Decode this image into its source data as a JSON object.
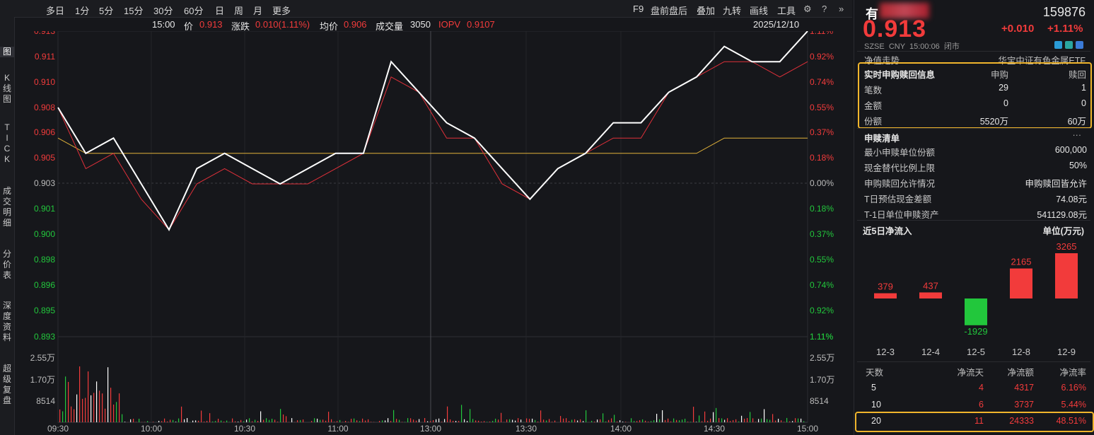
{
  "left_tabs": [
    {
      "label": "图",
      "active": true
    },
    {
      "label": "K\n线\n图"
    },
    {
      "label": "T\nI\nC\nK"
    },
    {
      "label": "成\n交\n明\n细"
    },
    {
      "label": "分\n价\n表"
    },
    {
      "label": "深\n度\n资\n料"
    },
    {
      "label": "超\n级\n复\n盘"
    }
  ],
  "toolbar": {
    "periods": [
      "多日",
      "1分",
      "5分",
      "15分",
      "30分",
      "60分",
      "日",
      "周",
      "月",
      "更多"
    ],
    "right": [
      "F9",
      "盘前盘后",
      "叠加",
      "九转",
      "画线",
      "工具"
    ],
    "icons": [
      "gear-icon",
      "help-icon",
      "double-chevron-right-icon"
    ]
  },
  "info": {
    "time": "15:00",
    "price_label": "价",
    "price": "0.913",
    "change_label": "涨跌",
    "change": "0.010(1.11%)",
    "avg_label": "均价",
    "avg": "0.906",
    "vol_label": "成交量",
    "vol": "3050",
    "iopv_label": "IOPV",
    "iopv": "0.9107",
    "date": "2025/12/10"
  },
  "y_left": [
    "0.913",
    "0.911",
    "0.910",
    "0.908",
    "0.906",
    "0.905",
    "0.903",
    "0.901",
    "0.900",
    "0.898",
    "0.896",
    "0.895",
    "0.893"
  ],
  "y_right": [
    "1.11%",
    "0.92%",
    "0.74%",
    "0.55%",
    "0.37%",
    "0.18%",
    "0.00%",
    "0.18%",
    "0.37%",
    "0.55%",
    "0.74%",
    "0.92%",
    "1.11%"
  ],
  "vol_left": [
    "2.55万",
    "1.70万",
    "8514"
  ],
  "vol_right": [
    "1.11%",
    "2.55万",
    "1.70万",
    "8514"
  ],
  "x_labels": [
    "09:30",
    "10:00",
    "10:30",
    "11:00",
    "13:00",
    "13:30",
    "14:00",
    "14:30",
    "15:00"
  ],
  "quote": {
    "name": "有",
    "code": "159876",
    "price": "0.913",
    "change": "+0.010",
    "change_pct": "+1.11%",
    "meta": "SZSE  CNY  15:00:06  闭市"
  },
  "nav": {
    "label": "净值走势",
    "fund_name": "华宝中证有色金属ETF"
  },
  "realtime": {
    "title": "实时申购赎回信息",
    "col1": "申购",
    "col2": "赎回",
    "rows": [
      {
        "label": "笔数",
        "sub": "29",
        "red": "1"
      },
      {
        "label": "金额",
        "sub": "0",
        "red": "0"
      },
      {
        "label": "份额",
        "sub": "5520万",
        "red": "60万"
      }
    ]
  },
  "list": {
    "title": "申赎清单",
    "more": "···",
    "rows": [
      {
        "label": "最小申赎单位份额",
        "value": "600,000"
      },
      {
        "label": "现金替代比例上限",
        "value": "50%"
      },
      {
        "label": "申购赎回允许情况",
        "value": "申购赎回皆允许"
      },
      {
        "label": "T日预估现金差额",
        "value": "74.08元"
      },
      {
        "label": "T-1日单位申赎资产",
        "value": "541129.08元"
      }
    ]
  },
  "netflow": {
    "title": "近5日净流入",
    "unit": "单位(万元)",
    "bars": [
      {
        "date": "12-3",
        "value": 379
      },
      {
        "date": "12-4",
        "value": 437
      },
      {
        "date": "12-5",
        "value": -1929
      },
      {
        "date": "12-8",
        "value": 2165
      },
      {
        "date": "12-9",
        "value": 3265
      }
    ]
  },
  "summary": {
    "headers": [
      "天数",
      "净流天",
      "净流额",
      "净流率"
    ],
    "rows": [
      {
        "days": "5",
        "d": "4",
        "amt": "4317",
        "rate": "6.16%"
      },
      {
        "days": "10",
        "d": "6",
        "amt": "3737",
        "rate": "5.44%"
      },
      {
        "days": "20",
        "d": "11",
        "amt": "24333",
        "rate": "48.51%"
      }
    ]
  },
  "colors": {
    "up": "#f23b3b",
    "down": "#22c73c",
    "price_line": "#ffffff",
    "iopv_line": "#e0303a",
    "avg_line": "#e0b13a",
    "highlight": "#f0b52c"
  },
  "chart_data": {
    "type": "line",
    "title": "",
    "ylim": [
      0.893,
      0.913
    ],
    "x": [
      "09:30",
      "09:35",
      "09:40",
      "09:45",
      "09:50",
      "09:55",
      "10:00",
      "10:10",
      "10:20",
      "10:30",
      "10:40",
      "10:50",
      "11:00",
      "11:10",
      "11:20",
      "11:30",
      "13:10",
      "13:20",
      "13:30",
      "13:40",
      "13:50",
      "14:00",
      "14:10",
      "14:20",
      "14:30",
      "14:40",
      "14:50",
      "15:00"
    ],
    "series": [
      {
        "name": "价",
        "values": [
          0.908,
          0.905,
          0.906,
          0.903,
          0.9,
          0.904,
          0.905,
          0.904,
          0.903,
          0.904,
          0.905,
          0.905,
          0.911,
          0.909,
          0.907,
          0.906,
          0.904,
          0.902,
          0.904,
          0.905,
          0.907,
          0.907,
          0.909,
          0.91,
          0.912,
          0.911,
          0.911,
          0.913
        ]
      },
      {
        "name": "IOPV",
        "values": [
          0.908,
          0.904,
          0.905,
          0.902,
          0.9,
          0.903,
          0.904,
          0.903,
          0.903,
          0.903,
          0.904,
          0.905,
          0.91,
          0.909,
          0.906,
          0.906,
          0.903,
          0.902,
          0.904,
          0.905,
          0.906,
          0.906,
          0.909,
          0.91,
          0.911,
          0.911,
          0.91,
          0.911
        ]
      },
      {
        "name": "均价",
        "values": [
          0.906,
          0.905,
          0.905,
          0.905,
          0.905,
          0.905,
          0.905,
          0.905,
          0.905,
          0.905,
          0.905,
          0.905,
          0.905,
          0.905,
          0.905,
          0.905,
          0.905,
          0.905,
          0.905,
          0.905,
          0.905,
          0.905,
          0.905,
          0.905,
          0.906,
          0.906,
          0.906,
          0.906
        ]
      }
    ]
  }
}
